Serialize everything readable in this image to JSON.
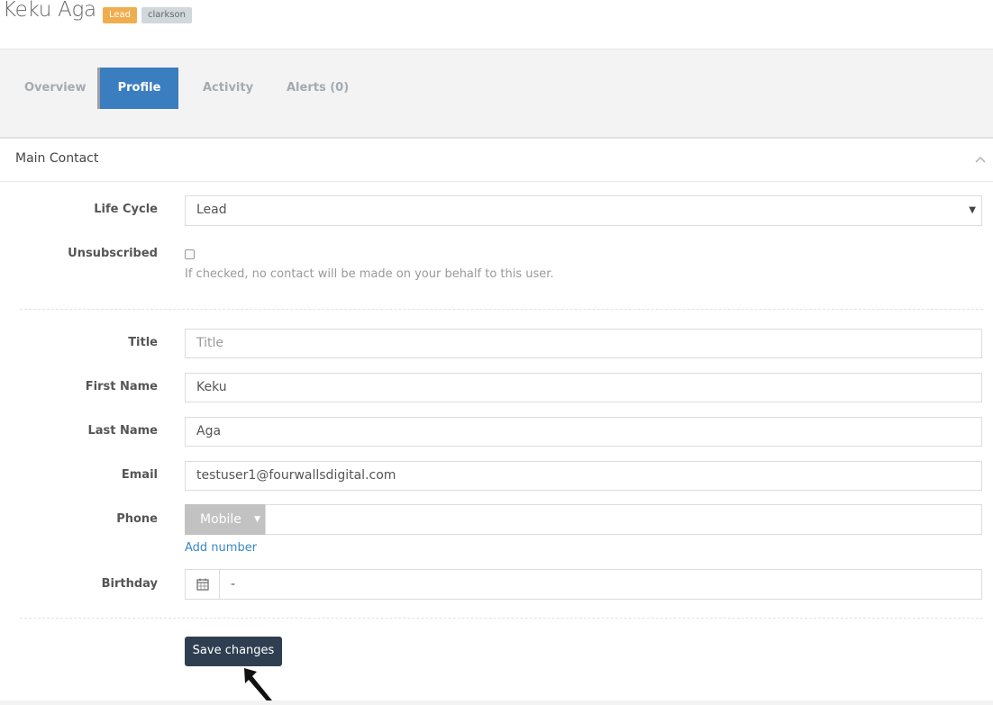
{
  "header": {
    "contact_name": "Keku Aga",
    "badge_lifecycle": "Lead",
    "badge_owner": "clarkson"
  },
  "tabs": [
    {
      "label": "Overview",
      "active": false
    },
    {
      "label": "Profile",
      "active": true
    },
    {
      "label": "Activity",
      "active": false
    },
    {
      "label": "Alerts (0)",
      "active": false
    }
  ],
  "panel": {
    "title": "Main Contact",
    "chevron_icon": "chevron-up-icon"
  },
  "form": {
    "life_cycle": {
      "label": "Life Cycle",
      "value": "Lead"
    },
    "unsubscribed": {
      "label": "Unsubscribed",
      "checked": false,
      "help": "If checked, no contact will be made on your behalf to this user."
    },
    "title": {
      "label": "Title",
      "value": "",
      "placeholder": "Title"
    },
    "first_name": {
      "label": "First Name",
      "value": "Keku"
    },
    "last_name": {
      "label": "Last Name",
      "value": "Aga"
    },
    "email": {
      "label": "Email",
      "value": "testuser1@fourwallsdigital.com"
    },
    "phone": {
      "label": "Phone",
      "type": "Mobile",
      "value": "",
      "add_label": "Add number"
    },
    "birthday": {
      "label": "Birthday",
      "value": "-",
      "icon": "calendar-icon"
    },
    "save_label": "Save changes"
  },
  "colors": {
    "active_tab": "#3b7ec0",
    "lead_badge": "#f0ad4e",
    "save_button": "#2f3f51",
    "link": "#3a87c8"
  }
}
